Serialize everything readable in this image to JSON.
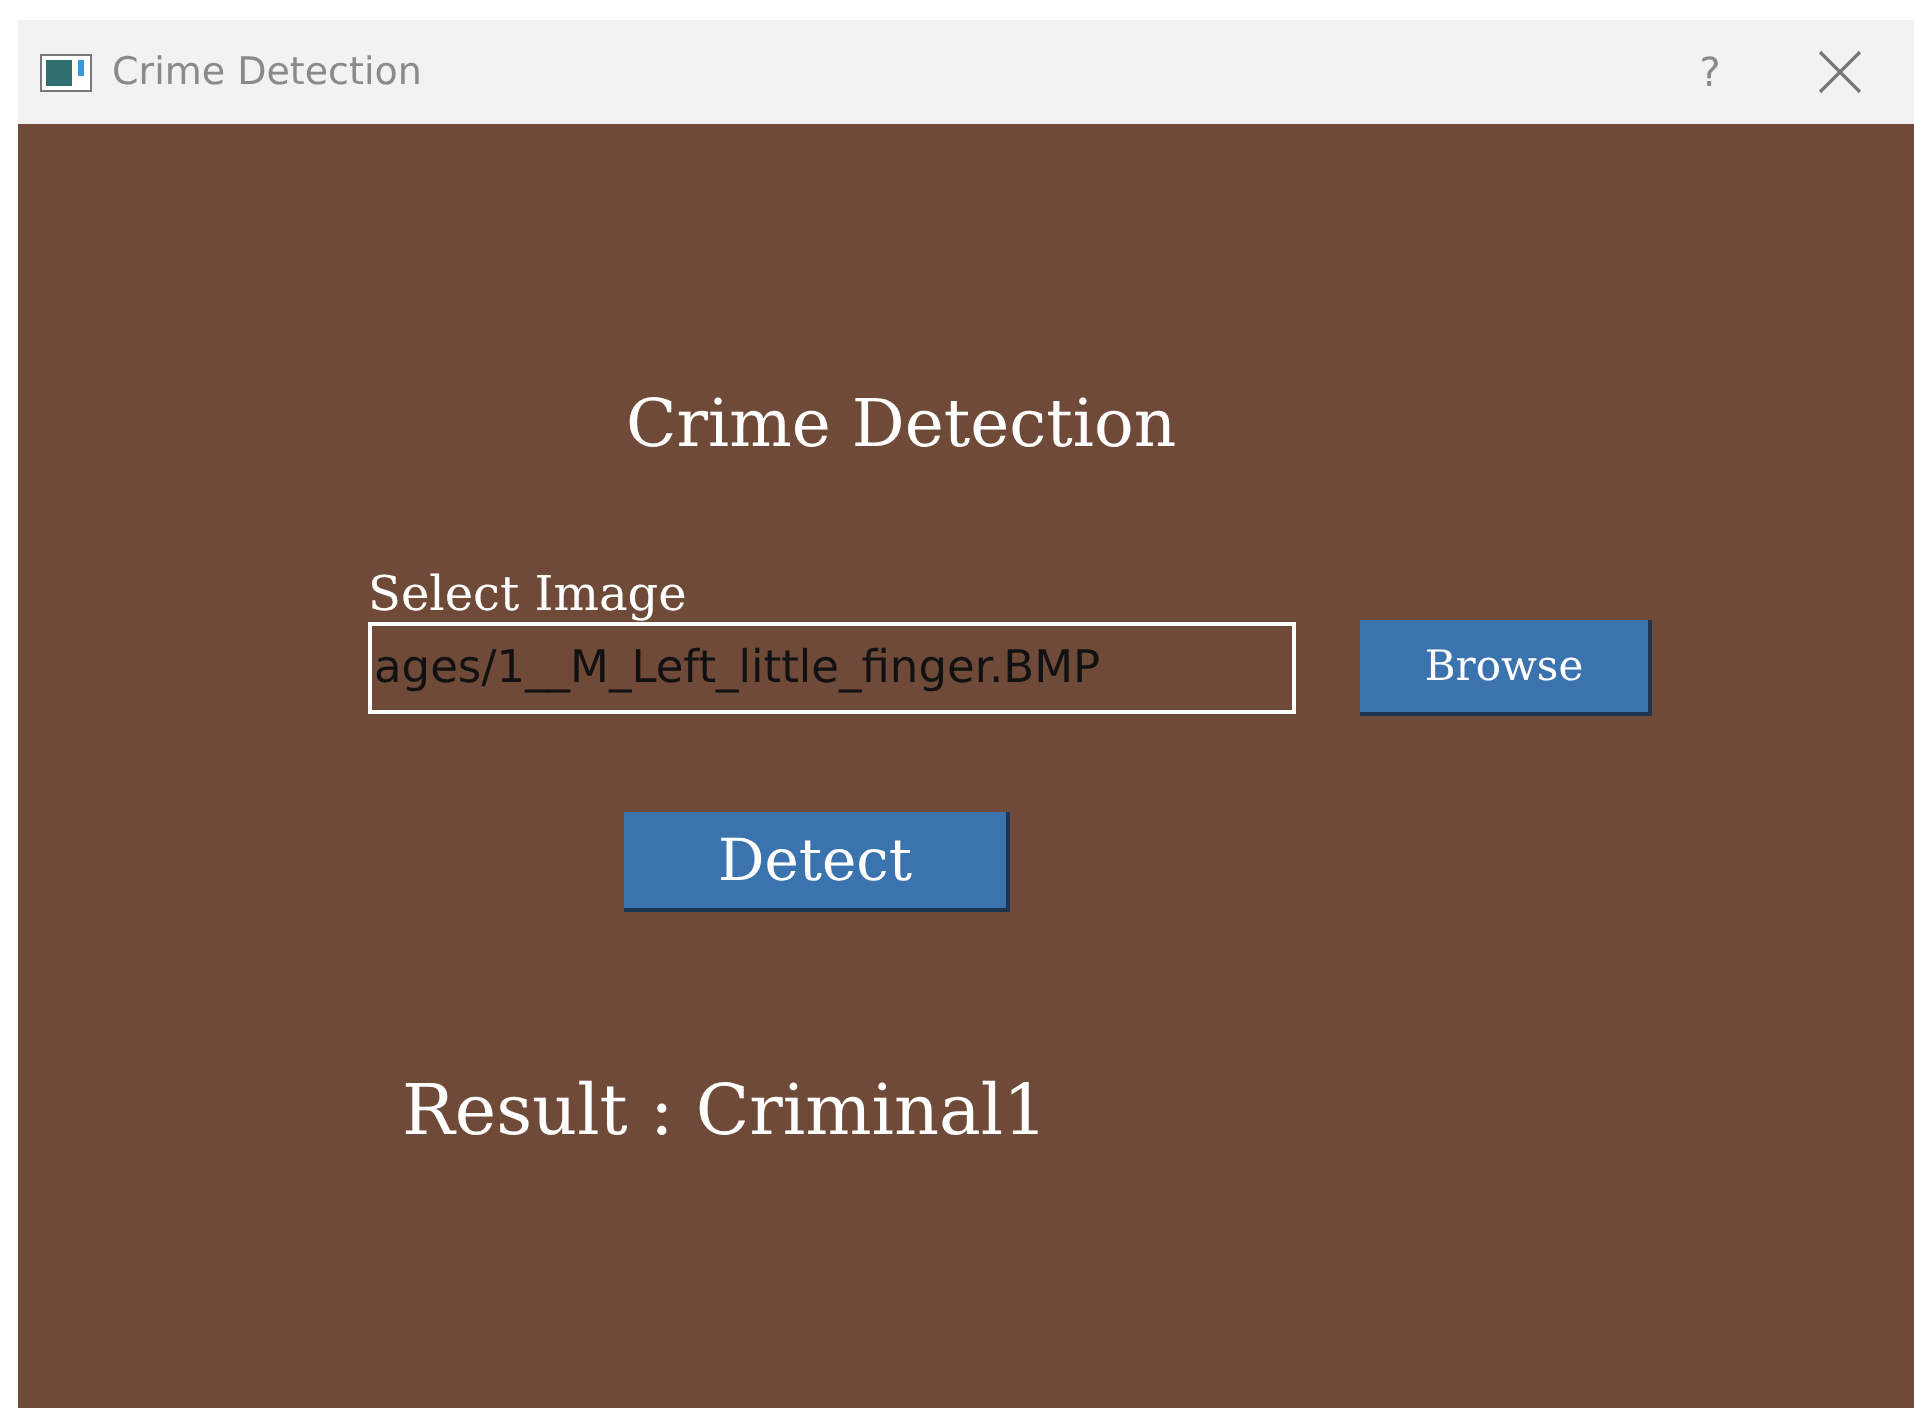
{
  "window": {
    "title": "Crime Detection",
    "help_button": "?"
  },
  "heading": "Crime Detection",
  "image_field": {
    "label": "Select Image",
    "value": "ages/1__M_Left_little_finger.BMP"
  },
  "browse_button": "Browse",
  "detect_button": "Detect",
  "result": "Result : Criminal1"
}
